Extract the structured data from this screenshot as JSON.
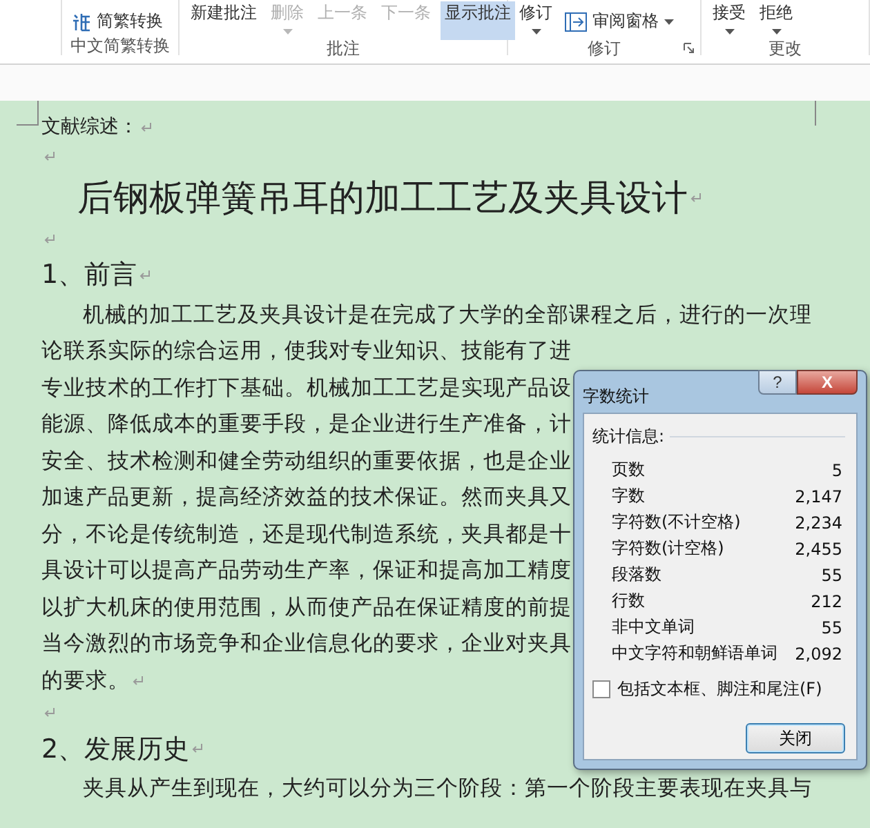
{
  "ribbon": {
    "groups": [
      {
        "label": "中文简繁转换",
        "launcher": false,
        "items": [
          {
            "kind": "convert",
            "label": "简繁转换",
            "dropdown": false
          }
        ]
      },
      {
        "label": "批注",
        "launcher": false,
        "items": [
          {
            "kind": "top",
            "label": "新建批注",
            "disabled": false,
            "selected": false,
            "dropdown": false
          },
          {
            "kind": "top",
            "label": "删除",
            "disabled": true,
            "selected": false,
            "dropdown": true
          },
          {
            "kind": "top",
            "label": "上一条",
            "disabled": true,
            "selected": false,
            "dropdown": false
          },
          {
            "kind": "top",
            "label": "下一条",
            "disabled": true,
            "selected": false,
            "dropdown": false
          },
          {
            "kind": "top",
            "label": "显示批注",
            "disabled": false,
            "selected": true,
            "dropdown": false
          }
        ]
      },
      {
        "label": "修订",
        "launcher": true,
        "items": [
          {
            "kind": "top",
            "label": "修订",
            "disabled": false,
            "selected": false,
            "dropdown": true
          },
          {
            "kind": "pane",
            "label": "审阅窗格",
            "dropdown": true
          }
        ]
      },
      {
        "label": "更改",
        "launcher": false,
        "items": [
          {
            "kind": "top",
            "label": "接受",
            "disabled": false,
            "selected": false,
            "dropdown": true
          },
          {
            "kind": "top",
            "label": "拒绝",
            "disabled": false,
            "selected": false,
            "dropdown": true
          }
        ]
      }
    ]
  },
  "document": {
    "blocks": [
      {
        "kind": "text",
        "text": "文献综述：",
        "mark": true
      },
      {
        "kind": "empty",
        "mark": true
      },
      {
        "kind": "title",
        "text": "后钢板弹簧吊耳的加工工艺及夹具设计",
        "mark": true
      },
      {
        "kind": "empty",
        "mark": true
      },
      {
        "kind": "heading",
        "text": "1、前言",
        "mark": true
      },
      {
        "kind": "line",
        "indent": true,
        "text": "机械的加工工艺及夹具设计是在完成了大学的全部课程之后，进行的一次理"
      },
      {
        "kind": "line",
        "indent": false,
        "text": "论联系实际的综合运用，使我对专业知识、技能有了进"
      },
      {
        "kind": "line",
        "indent": false,
        "text": "专业技术的工作打下基础。机械加工工艺是实现产品设"
      },
      {
        "kind": "line",
        "indent": false,
        "text": "能源、降低成本的重要手段，是企业进行生产准备，计"
      },
      {
        "kind": "line",
        "indent": false,
        "text": "安全、技术检测和健全劳动组织的重要依据，也是企业"
      },
      {
        "kind": "line",
        "indent": false,
        "text": "加速产品更新，提高经济效益的技术保证。然而夹具又"
      },
      {
        "kind": "line",
        "indent": false,
        "text": "分，不论是传统制造，还是现代制造系统，夹具都是十"
      },
      {
        "kind": "line",
        "indent": false,
        "text": "具设计可以提高产品劳动生产率，保证和提高加工精度"
      },
      {
        "kind": "line",
        "indent": false,
        "text": "以扩大机床的使用范围，从而使产品在保证精度的前提"
      },
      {
        "kind": "line",
        "indent": false,
        "text": "当今激烈的市场竞争和企业信息化的要求，企业对夹具"
      },
      {
        "kind": "line",
        "indent": false,
        "text": "的要求。",
        "mark": true
      },
      {
        "kind": "empty",
        "mark": true
      },
      {
        "kind": "heading",
        "text": "2、发展历史",
        "mark": true
      },
      {
        "kind": "line",
        "indent": true,
        "text": "夹具从产生到现在，大约可以分为三个阶段：第一个阶段主要表现在夹具与"
      }
    ]
  },
  "dialog": {
    "title": "字数统计",
    "help": "?",
    "close": "X",
    "group": "统计信息:",
    "stats": [
      {
        "label": "页数",
        "value": "5"
      },
      {
        "label": "字数",
        "value": "2,147"
      },
      {
        "label": "字符数(不计空格)",
        "value": "2,234"
      },
      {
        "label": "字符数(计空格)",
        "value": "2,455"
      },
      {
        "label": "段落数",
        "value": "55"
      },
      {
        "label": "行数",
        "value": "212"
      },
      {
        "label": "非中文单词",
        "value": "55"
      },
      {
        "label": "中文字符和朝鲜语单词",
        "value": "2,092"
      }
    ],
    "checkbox": {
      "label": "包括文本框、脚注和尾注(F)",
      "checked": false
    },
    "button": "关闭"
  }
}
